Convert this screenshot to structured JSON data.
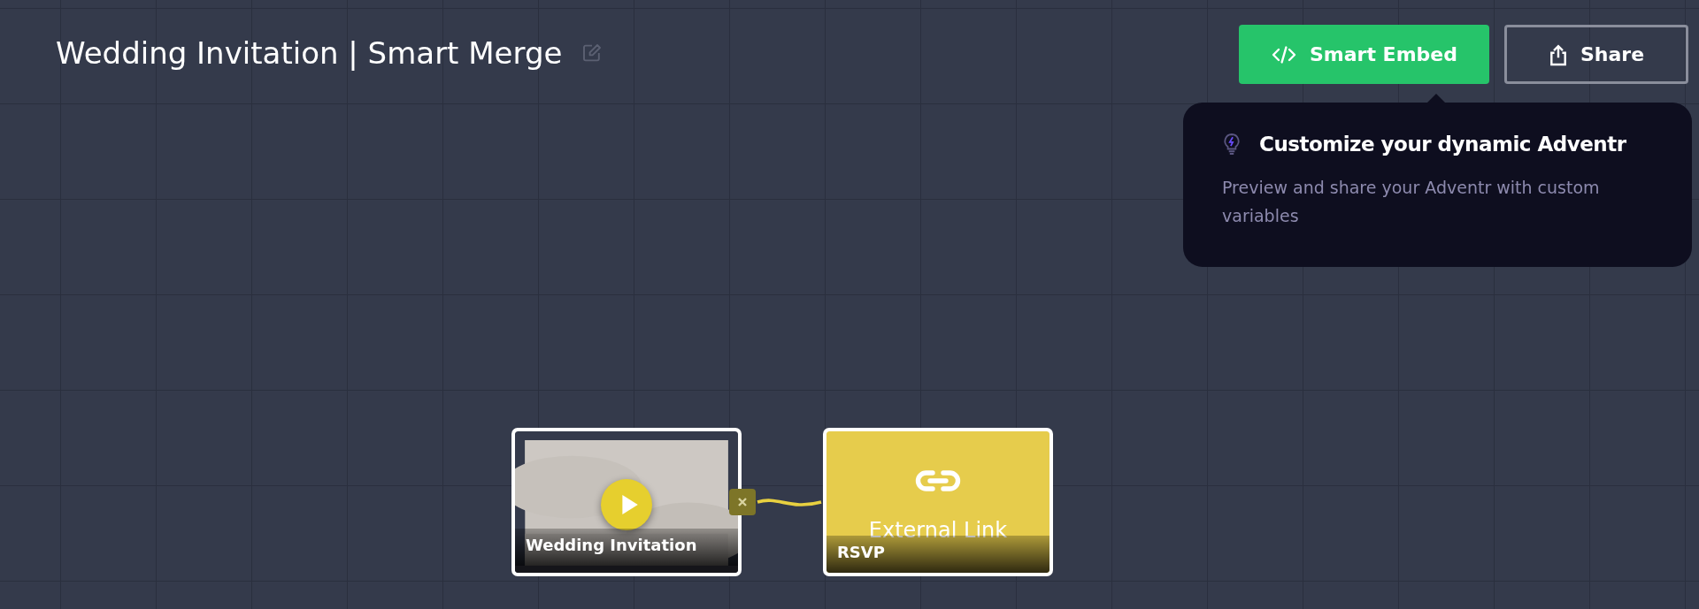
{
  "title": "Wedding Invitation | Smart Merge",
  "buttons": [
    {
      "kind": "embed",
      "label": "Smart Embed"
    },
    {
      "kind": "share",
      "label": "Share"
    }
  ],
  "tooltip": {
    "title": "Customize your dynamic Adventr",
    "text": "Preview and share your Adventr with custom variables"
  },
  "nodes": [
    {
      "kind": "video",
      "label": "Wedding Invitation"
    },
    {
      "kind": "link",
      "type_label": "External Link",
      "label": "RSVP"
    }
  ]
}
